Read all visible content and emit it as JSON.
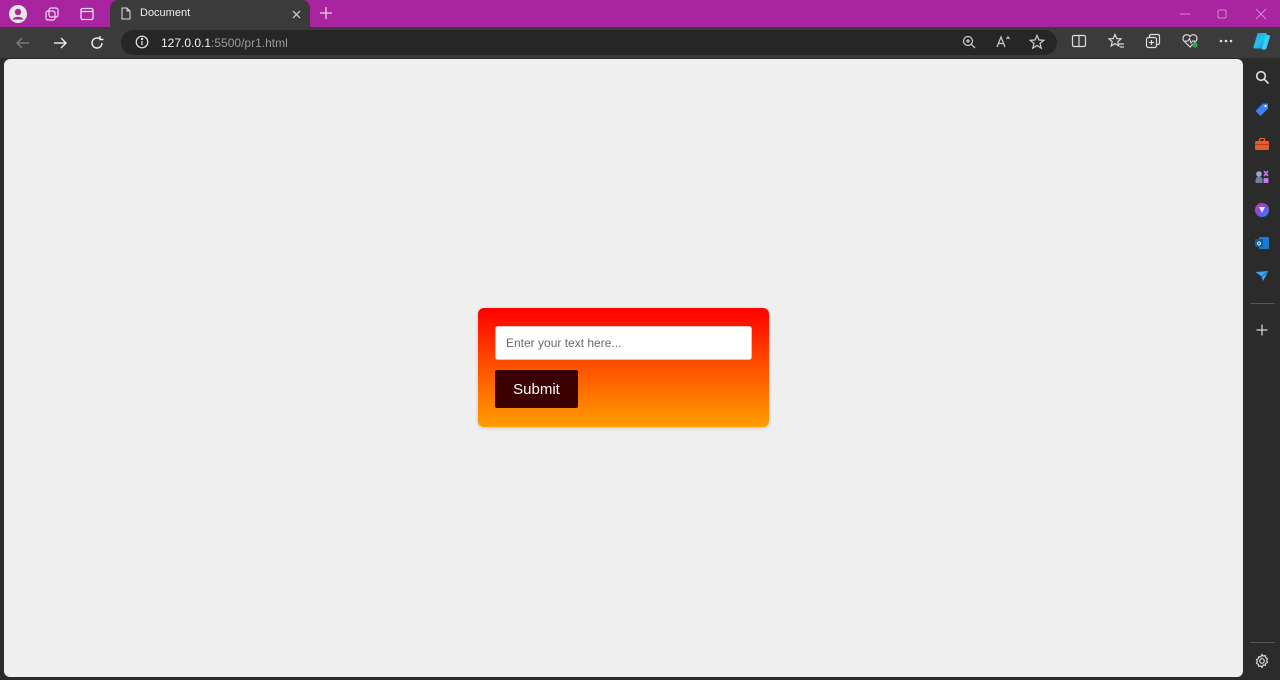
{
  "browser": {
    "tab": {
      "title": "Document"
    },
    "address": {
      "host": "127.0.0.1",
      "rest": ":5500/pr1.html"
    }
  },
  "form": {
    "input_placeholder": "Enter your text here...",
    "input_value": "",
    "submit_label": "Submit"
  },
  "colors": {
    "titlebar": "#a8259f",
    "gradient_top": "#ff0000",
    "gradient_bottom": "#ff9d00",
    "button_bg": "#3b0000"
  },
  "icons": {
    "titlebar": [
      "profile-icon",
      "workspaces-icon",
      "tab-actions-icon"
    ],
    "toolbar": [
      "back-icon",
      "forward-icon",
      "refresh-icon",
      "zoom-icon",
      "read-aloud-icon",
      "favorite-star-icon",
      "split-screen-icon",
      "favorites-icon",
      "collections-icon",
      "browser-essentials-icon",
      "more-icon",
      "copilot-icon"
    ],
    "sidebar": [
      "search-icon",
      "shopping-icon",
      "tools-icon",
      "games-icon",
      "microsoft365-icon",
      "outlook-icon",
      "send-icon",
      "add-icon",
      "settings-icon"
    ]
  }
}
